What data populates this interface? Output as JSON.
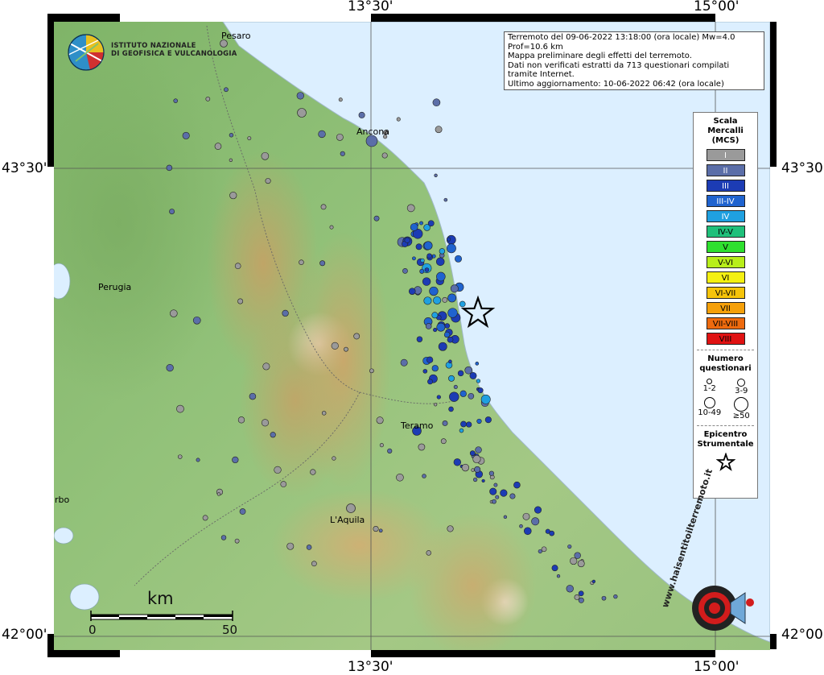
{
  "axes": {
    "top": [
      "13°30'",
      "15°00'"
    ],
    "bottom": [
      "13°30'",
      "15°00'"
    ],
    "left": [
      "43°30'",
      "42°00'"
    ],
    "right": [
      "43°30'",
      "42°00'"
    ]
  },
  "institute": {
    "line1": "ISTITUTO NAZIONALE",
    "line2": "DI GEOFISICA E VULCANOLOGIA"
  },
  "info": {
    "line1": "Terremoto del 09-06-2022 13:18:00 (ora locale) Mw=4.0 Prof=10.6 km",
    "line2": "Mappa preliminare degli effetti del terremoto.",
    "line3": "Dati non verificati estratti da 713 questionari compilati tramite Internet.",
    "line4": "Ultimo aggiornamento: 10-06-2022 06:42 (ora locale)"
  },
  "places": {
    "pesaro": "Pesaro",
    "ancona": "Ancona",
    "perugia": "Perugia",
    "teramo": "Teramo",
    "laquila": "L'Aquila",
    "viterbo": "rbo"
  },
  "legend": {
    "scale_title_1": "Scala",
    "scale_title_2": "Mercalli",
    "scale_title_3": "(MCS)",
    "levels": [
      {
        "label": "I",
        "color": "#9a9a9a",
        "text": "#ffffff"
      },
      {
        "label": "II",
        "color": "#5b6ea8",
        "text": "#ffffff"
      },
      {
        "label": "III",
        "color": "#1c3cb4",
        "text": "#ffffff"
      },
      {
        "label": "III-IV",
        "color": "#1f63cf",
        "text": "#ffffff"
      },
      {
        "label": "IV",
        "color": "#1fa0e0",
        "text": "#ffffff"
      },
      {
        "label": "IV-V",
        "color": "#1fc07a",
        "text": "#000000"
      },
      {
        "label": "V",
        "color": "#2ee02e",
        "text": "#000000"
      },
      {
        "label": "V-VI",
        "color": "#b8ee1a",
        "text": "#000000"
      },
      {
        "label": "VI",
        "color": "#f4f012",
        "text": "#000000"
      },
      {
        "label": "VI-VII",
        "color": "#f6c40a",
        "text": "#000000"
      },
      {
        "label": "VII",
        "color": "#f5a00a",
        "text": "#000000"
      },
      {
        "label": "VII-VIII",
        "color": "#ee6a0e",
        "text": "#000000"
      },
      {
        "label": "VIII",
        "color": "#e01212",
        "text": "#000000"
      }
    ],
    "count_title_1": "Numero",
    "count_title_2": "questionari",
    "counts": [
      "1-2",
      "3-9",
      "10-49",
      "≥50"
    ],
    "epicenter_title_1": "Epicentro",
    "epicenter_title_2": "Strumentale"
  },
  "scalebar": {
    "unit": "km",
    "start": "0",
    "end": "50"
  },
  "watermark": {
    "text": "www.haisentitoilterremoto.it"
  },
  "colors": {
    "sea": "#dcefff",
    "land": "#8fbf72",
    "highland": "#c9a66a",
    "epicenter": "#000000"
  }
}
